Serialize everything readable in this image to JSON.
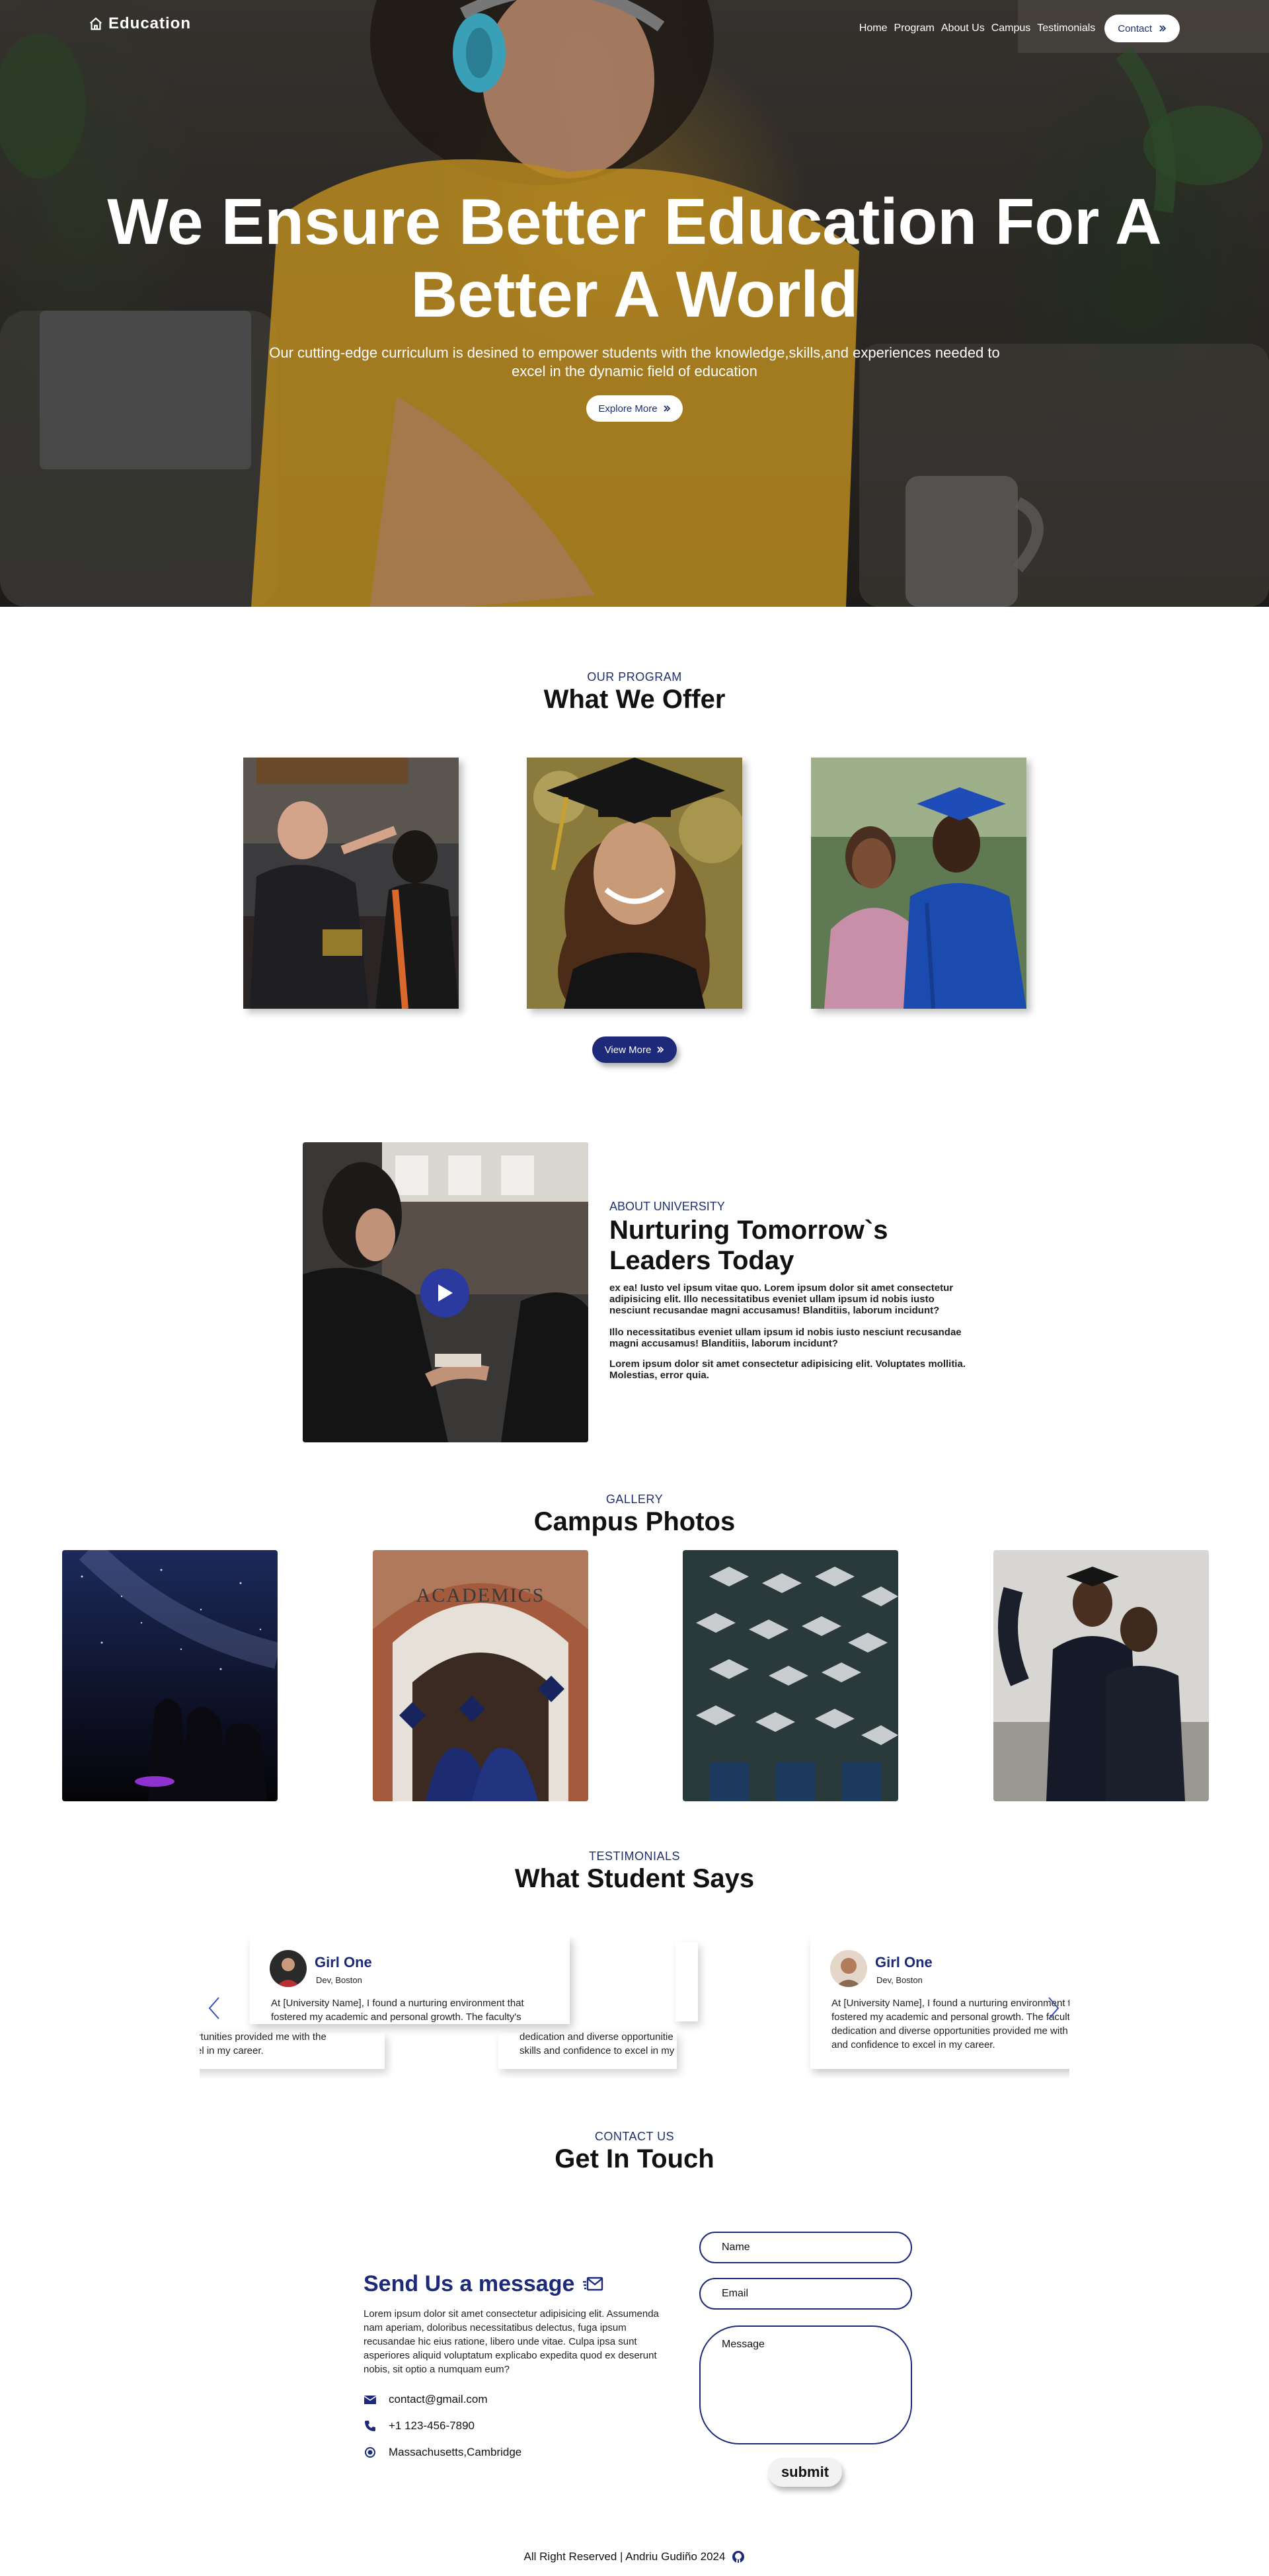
{
  "nav": {
    "logo": "Education",
    "links": [
      "Home",
      "Program",
      "About Us",
      "Campus",
      "Testimonials"
    ],
    "contact_label": "Contact"
  },
  "hero": {
    "title_line1": "We Ensure Better Education For A",
    "title_line2": "Better A World",
    "subtitle": "Our cutting-edge curriculum is desined to empower students with the knowledge,skills,and experiences needed to excel in the dynamic field of education",
    "cta_label": "Explore More"
  },
  "program": {
    "eyebrow": "OUR PROGRAM",
    "title": "What We Offer",
    "view_more_label": "View More"
  },
  "about": {
    "eyebrow": "ABOUT UNIVERSITY",
    "title": "Nurturing Tomorrow`s Leaders Today",
    "paragraphs": [
      "ex ea! Iusto vel ipsum vitae quo. Lorem ipsum dolor sit amet consectetur adipisicing elit. Illo necessitatibus eveniet ullam ipsum id nobis iusto nesciunt recusandae magni accusamus! Blanditiis, laborum incidunt?",
      "Illo necessitatibus eveniet ullam ipsum id nobis iusto nesciunt recusandae magni accusamus! Blanditiis, laborum incidunt?",
      "Lorem ipsum dolor sit amet consectetur adipisicing elit. Voluptates mollitia. Molestias, error quia."
    ]
  },
  "gallery": {
    "eyebrow": "GALLERY",
    "title": "Campus Photos",
    "academics_sign": "ACADEMICS"
  },
  "testimonials": {
    "eyebrow": "TESTIMONIALS",
    "title": "What Student Says",
    "items": [
      {
        "name": "Girl One",
        "role": "Dev, Boston",
        "text": "At [University Name], I found a nurturing environment that fostered my academic and personal growth. The faculty's dedication and diverse opportunities provided me with the skills and confidence to excel in my career."
      },
      {
        "name": "Girl One",
        "role": "Dev, Boston",
        "text": "At [University Name], I found a nurturing environment that fostered my academic and personal growth. The faculty's dedication and diverse opportunities provided me with the skills and confidence to excel in my career."
      }
    ],
    "ghost_lines": {
      "left_1": "portunities provided me with the",
      "left_2": "xcel in my career.",
      "mid_1": "dedication and diverse opportunitie",
      "mid_2": "skills and confidence to excel in my"
    }
  },
  "contact": {
    "eyebrow": "CONTACT US",
    "title": "Get In Touch",
    "send_title": "Send Us a message",
    "send_text": "Lorem ipsum dolor sit amet consectetur adipisicing elit. Assumenda nam aperiam, doloribus necessitatibus delectus, fuga ipsum recusandae hic eius ratione, libero unde vitae. Culpa ipsa sunt asperiores aliquid voluptatum explicabo expedita quod ex deserunt nobis, sit optio a numquam eum?",
    "email": "contact@gmail.com",
    "phone": "+1 123-456-7890",
    "address": "Massachusetts,Cambridge",
    "form": {
      "name_placeholder": "Name",
      "email_placeholder": "Email",
      "message_placeholder": "Message",
      "submit_label": "submit"
    }
  },
  "footer": {
    "text": "All Right Reserved | Andriu Gudiño 2024"
  },
  "colors": {
    "brand_navy": "#1d2a7a",
    "accent_blue": "#2a3a9e"
  }
}
